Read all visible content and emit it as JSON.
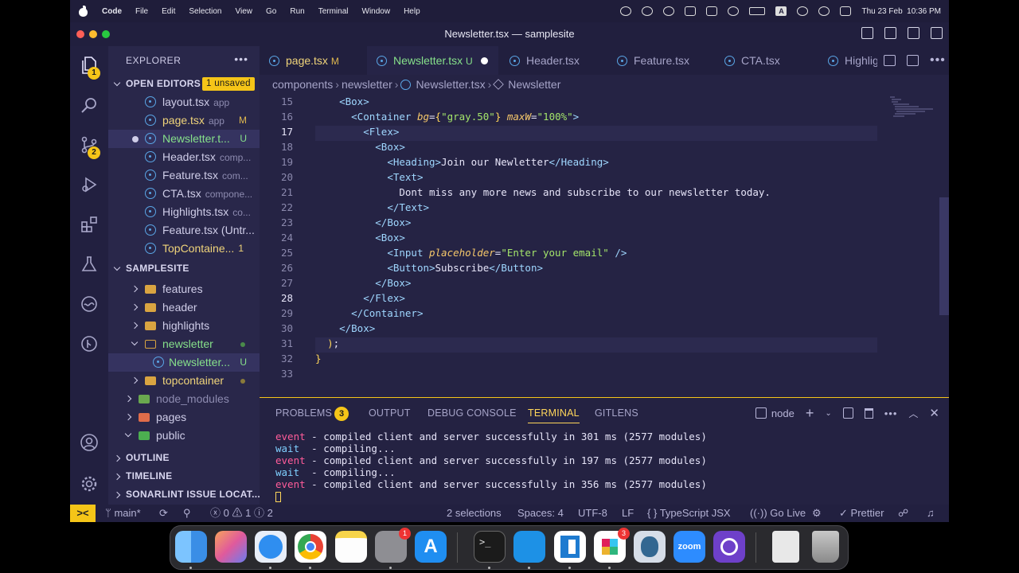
{
  "menubar": {
    "app": "Code",
    "items": [
      "File",
      "Edit",
      "Selection",
      "View",
      "Go",
      "Run",
      "Terminal",
      "Window",
      "Help"
    ],
    "datetime": "Thu 23 Feb  10:36 PM",
    "input_indicator": "A"
  },
  "window": {
    "title": "Newsletter.tsx — samplesite"
  },
  "activity": {
    "explorer_badge": "1",
    "scm_badge": "2"
  },
  "sidebar": {
    "header": "EXPLORER",
    "open_editors": {
      "title": "OPEN EDITORS",
      "badge": "1 unsaved",
      "files": [
        {
          "name": "layout.tsx",
          "hint": "app",
          "status": ""
        },
        {
          "name": "page.tsx",
          "hint": "app",
          "status": "M"
        },
        {
          "name": "Newsletter.t...",
          "hint": "",
          "status": "U"
        },
        {
          "name": "Header.tsx",
          "hint": "comp...",
          "status": ""
        },
        {
          "name": "Feature.tsx",
          "hint": "com...",
          "status": ""
        },
        {
          "name": "CTA.tsx",
          "hint": "compone...",
          "status": ""
        },
        {
          "name": "Highlights.tsx",
          "hint": "co...",
          "status": ""
        },
        {
          "name": "Feature.tsx (Untr...",
          "hint": "",
          "status": ""
        },
        {
          "name": "TopContaine...",
          "hint": "",
          "status": "1"
        }
      ]
    },
    "project": {
      "title": "SAMPLESITE",
      "items": [
        {
          "name": "features"
        },
        {
          "name": "header"
        },
        {
          "name": "highlights"
        },
        {
          "name": "newsletter"
        },
        {
          "name": "Newsletter...",
          "status": "U"
        },
        {
          "name": "topcontainer"
        },
        {
          "name": "node_modules"
        },
        {
          "name": "pages"
        },
        {
          "name": "public"
        }
      ]
    },
    "outline": "OUTLINE",
    "timeline": "TIMELINE",
    "sonarlint": "SONARLINT ISSUE LOCAT..."
  },
  "tabs": [
    {
      "label": "page.tsx",
      "status": "M"
    },
    {
      "label": "Newsletter.tsx",
      "status": "U"
    },
    {
      "label": "Header.tsx",
      "status": ""
    },
    {
      "label": "Feature.tsx",
      "status": ""
    },
    {
      "label": "CTA.tsx",
      "status": ""
    },
    {
      "label": "Highlig",
      "status": ""
    }
  ],
  "breadcrumb": [
    "components",
    "newsletter",
    "Newsletter.tsx",
    "Newsletter"
  ],
  "code": {
    "line_numbers": [
      "15",
      "16",
      "17",
      "18",
      "19",
      "20",
      "21",
      "22",
      "23",
      "24",
      "25",
      "26",
      "27",
      "28",
      "29",
      "30",
      "31",
      "32",
      "33"
    ],
    "lines": [
      [
        "    ",
        {
          "c": "tg",
          "t": "<Box>"
        }
      ],
      [
        "      ",
        {
          "c": "tg",
          "t": "<Container "
        },
        {
          "c": "at",
          "t": "bg"
        },
        {
          "c": "tx",
          "t": "="
        },
        {
          "c": "pu",
          "t": "{"
        },
        {
          "c": "sv",
          "t": "\"gray.50\""
        },
        {
          "c": "pu",
          "t": "}"
        },
        {
          "c": "tx",
          "t": " "
        },
        {
          "c": "at",
          "t": "maxW"
        },
        {
          "c": "tx",
          "t": "="
        },
        {
          "c": "sv",
          "t": "\"100%\""
        },
        {
          "c": "tg",
          "t": ">"
        }
      ],
      [
        "        ",
        {
          "c": "tg",
          "t": "<Flex>"
        }
      ],
      [
        "          ",
        {
          "c": "tg",
          "t": "<Box>"
        }
      ],
      [
        "            ",
        {
          "c": "tg",
          "t": "<Heading>"
        },
        {
          "c": "tx",
          "t": "Join our Newletter"
        },
        {
          "c": "tg",
          "t": "</Heading>"
        }
      ],
      [
        "            ",
        {
          "c": "tg",
          "t": "<Text>"
        }
      ],
      [
        "              ",
        {
          "c": "tx",
          "t": "Dont miss any more news and subscribe to our newsletter today."
        }
      ],
      [
        "            ",
        {
          "c": "tg",
          "t": "</Text>"
        }
      ],
      [
        "          ",
        {
          "c": "tg",
          "t": "</Box>"
        }
      ],
      [
        "          ",
        {
          "c": "tg",
          "t": "<Box>"
        }
      ],
      [
        "            ",
        {
          "c": "tg",
          "t": "<Input "
        },
        {
          "c": "at",
          "t": "placeholder"
        },
        {
          "c": "tx",
          "t": "="
        },
        {
          "c": "sv",
          "t": "\"Enter your email\""
        },
        {
          "c": "tg",
          "t": " />"
        }
      ],
      [
        "            ",
        {
          "c": "tg",
          "t": "<Button>"
        },
        {
          "c": "tx",
          "t": "Subscribe"
        },
        {
          "c": "tg",
          "t": "</Button>"
        }
      ],
      [
        "          ",
        {
          "c": "tg",
          "t": "</Box>"
        }
      ],
      [
        "        ",
        {
          "c": "tg",
          "t": "</Flex>"
        }
      ],
      [
        "      ",
        {
          "c": "tg",
          "t": "</Container>"
        }
      ],
      [
        "    ",
        {
          "c": "tg",
          "t": "</Box>"
        }
      ],
      [
        "  ",
        {
          "c": "pu",
          "t": ")"
        },
        {
          "c": "tx",
          "t": ";"
        }
      ],
      [
        {
          "c": "pu",
          "t": "}"
        }
      ],
      [
        ""
      ]
    ]
  },
  "panel": {
    "tabs": [
      "PROBLEMS",
      "OUTPUT",
      "DEBUG CONSOLE",
      "TERMINAL",
      "GITLENS"
    ],
    "problems_count": "3",
    "shell": "node",
    "terminal_lines": [
      {
        "kind": "event",
        "tag": "event",
        "text": " - compiled client and server successfully in 301 ms (2577 modules)"
      },
      {
        "kind": "wait",
        "tag": "wait ",
        "text": " - compiling..."
      },
      {
        "kind": "event",
        "tag": "event",
        "text": " - compiled client and server successfully in 197 ms (2577 modules)"
      },
      {
        "kind": "wait",
        "tag": "wait ",
        "text": " - compiling..."
      },
      {
        "kind": "event",
        "tag": "event",
        "text": " - compiled client and server successfully in 356 ms (2577 modules)"
      }
    ]
  },
  "statusbar": {
    "branch": "main*",
    "errors": "0",
    "warnings": "1",
    "info": "2",
    "selections": "2 selections",
    "spaces": "Spaces: 4",
    "encoding": "UTF-8",
    "eol": "LF",
    "language": "TypeScript JSX",
    "golive": "Go Live",
    "prettier": "Prettier"
  },
  "dock": {
    "apps": [
      "Finder",
      "Launchpad",
      "Safari",
      "Chrome",
      "Notes",
      "System Settings",
      "App Store",
      "Terminal",
      "Docker",
      "VS Code",
      "Slack",
      "pgAdmin",
      "Zoom",
      "GitHub Desktop",
      "Downloads",
      "Trash"
    ],
    "settings_badge": "1",
    "slack_badge": "3",
    "zoom_label": "zoom"
  },
  "colors": {
    "accent": "#f5c518",
    "tab_active_text": "#6fc1ff",
    "editor_bg": "#252344",
    "sidebar_bg": "#29274a"
  }
}
